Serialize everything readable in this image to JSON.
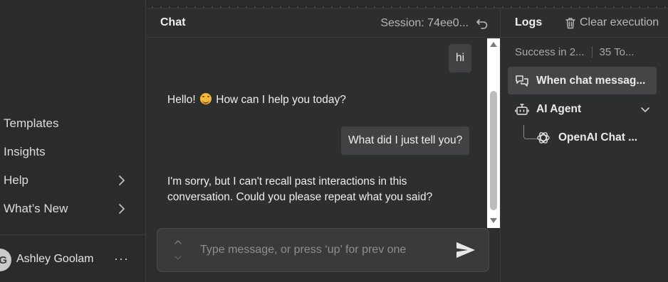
{
  "sidebar": {
    "items": [
      {
        "label": "Templates",
        "has_chevron": false
      },
      {
        "label": "Insights",
        "has_chevron": false
      },
      {
        "label": "Help",
        "has_chevron": true
      },
      {
        "label": "What’s New",
        "has_chevron": true
      }
    ],
    "user": {
      "initial": "G",
      "name": "Ashley Goolam",
      "more": "···"
    }
  },
  "chat": {
    "title": "Chat",
    "session": "Session: 74ee0...",
    "messages": [
      {
        "role": "user",
        "text": "hi"
      },
      {
        "role": "ai",
        "text": "Hello! ",
        "emoji": "smiling-face",
        "text_after": " How can I help you today?"
      },
      {
        "role": "user",
        "text": "What did I just tell you?"
      },
      {
        "role": "ai",
        "text": "I'm sorry, but I can't recall past interactions in this conversation. Could you please repeat what you said?"
      }
    ],
    "input_placeholder": "Type message, or press ‘up’ for prev one"
  },
  "logs": {
    "title": "Logs",
    "clear_label": "Clear execution",
    "status": "Success in 2...",
    "tokens": "35 To...",
    "items": [
      {
        "label": "When chat messag...",
        "icon": "chat-bubbles-icon",
        "active": true
      },
      {
        "label": "AI Agent",
        "icon": "robot-icon",
        "active": false,
        "expandable": true
      },
      {
        "label": "OpenAI Chat ...",
        "icon": "openai-icon",
        "active": false,
        "child": true
      }
    ]
  },
  "colors": {
    "background": "#2d2e2e",
    "bubble": "#424244",
    "active_item": "#454547",
    "text": "#e8e8e8"
  }
}
